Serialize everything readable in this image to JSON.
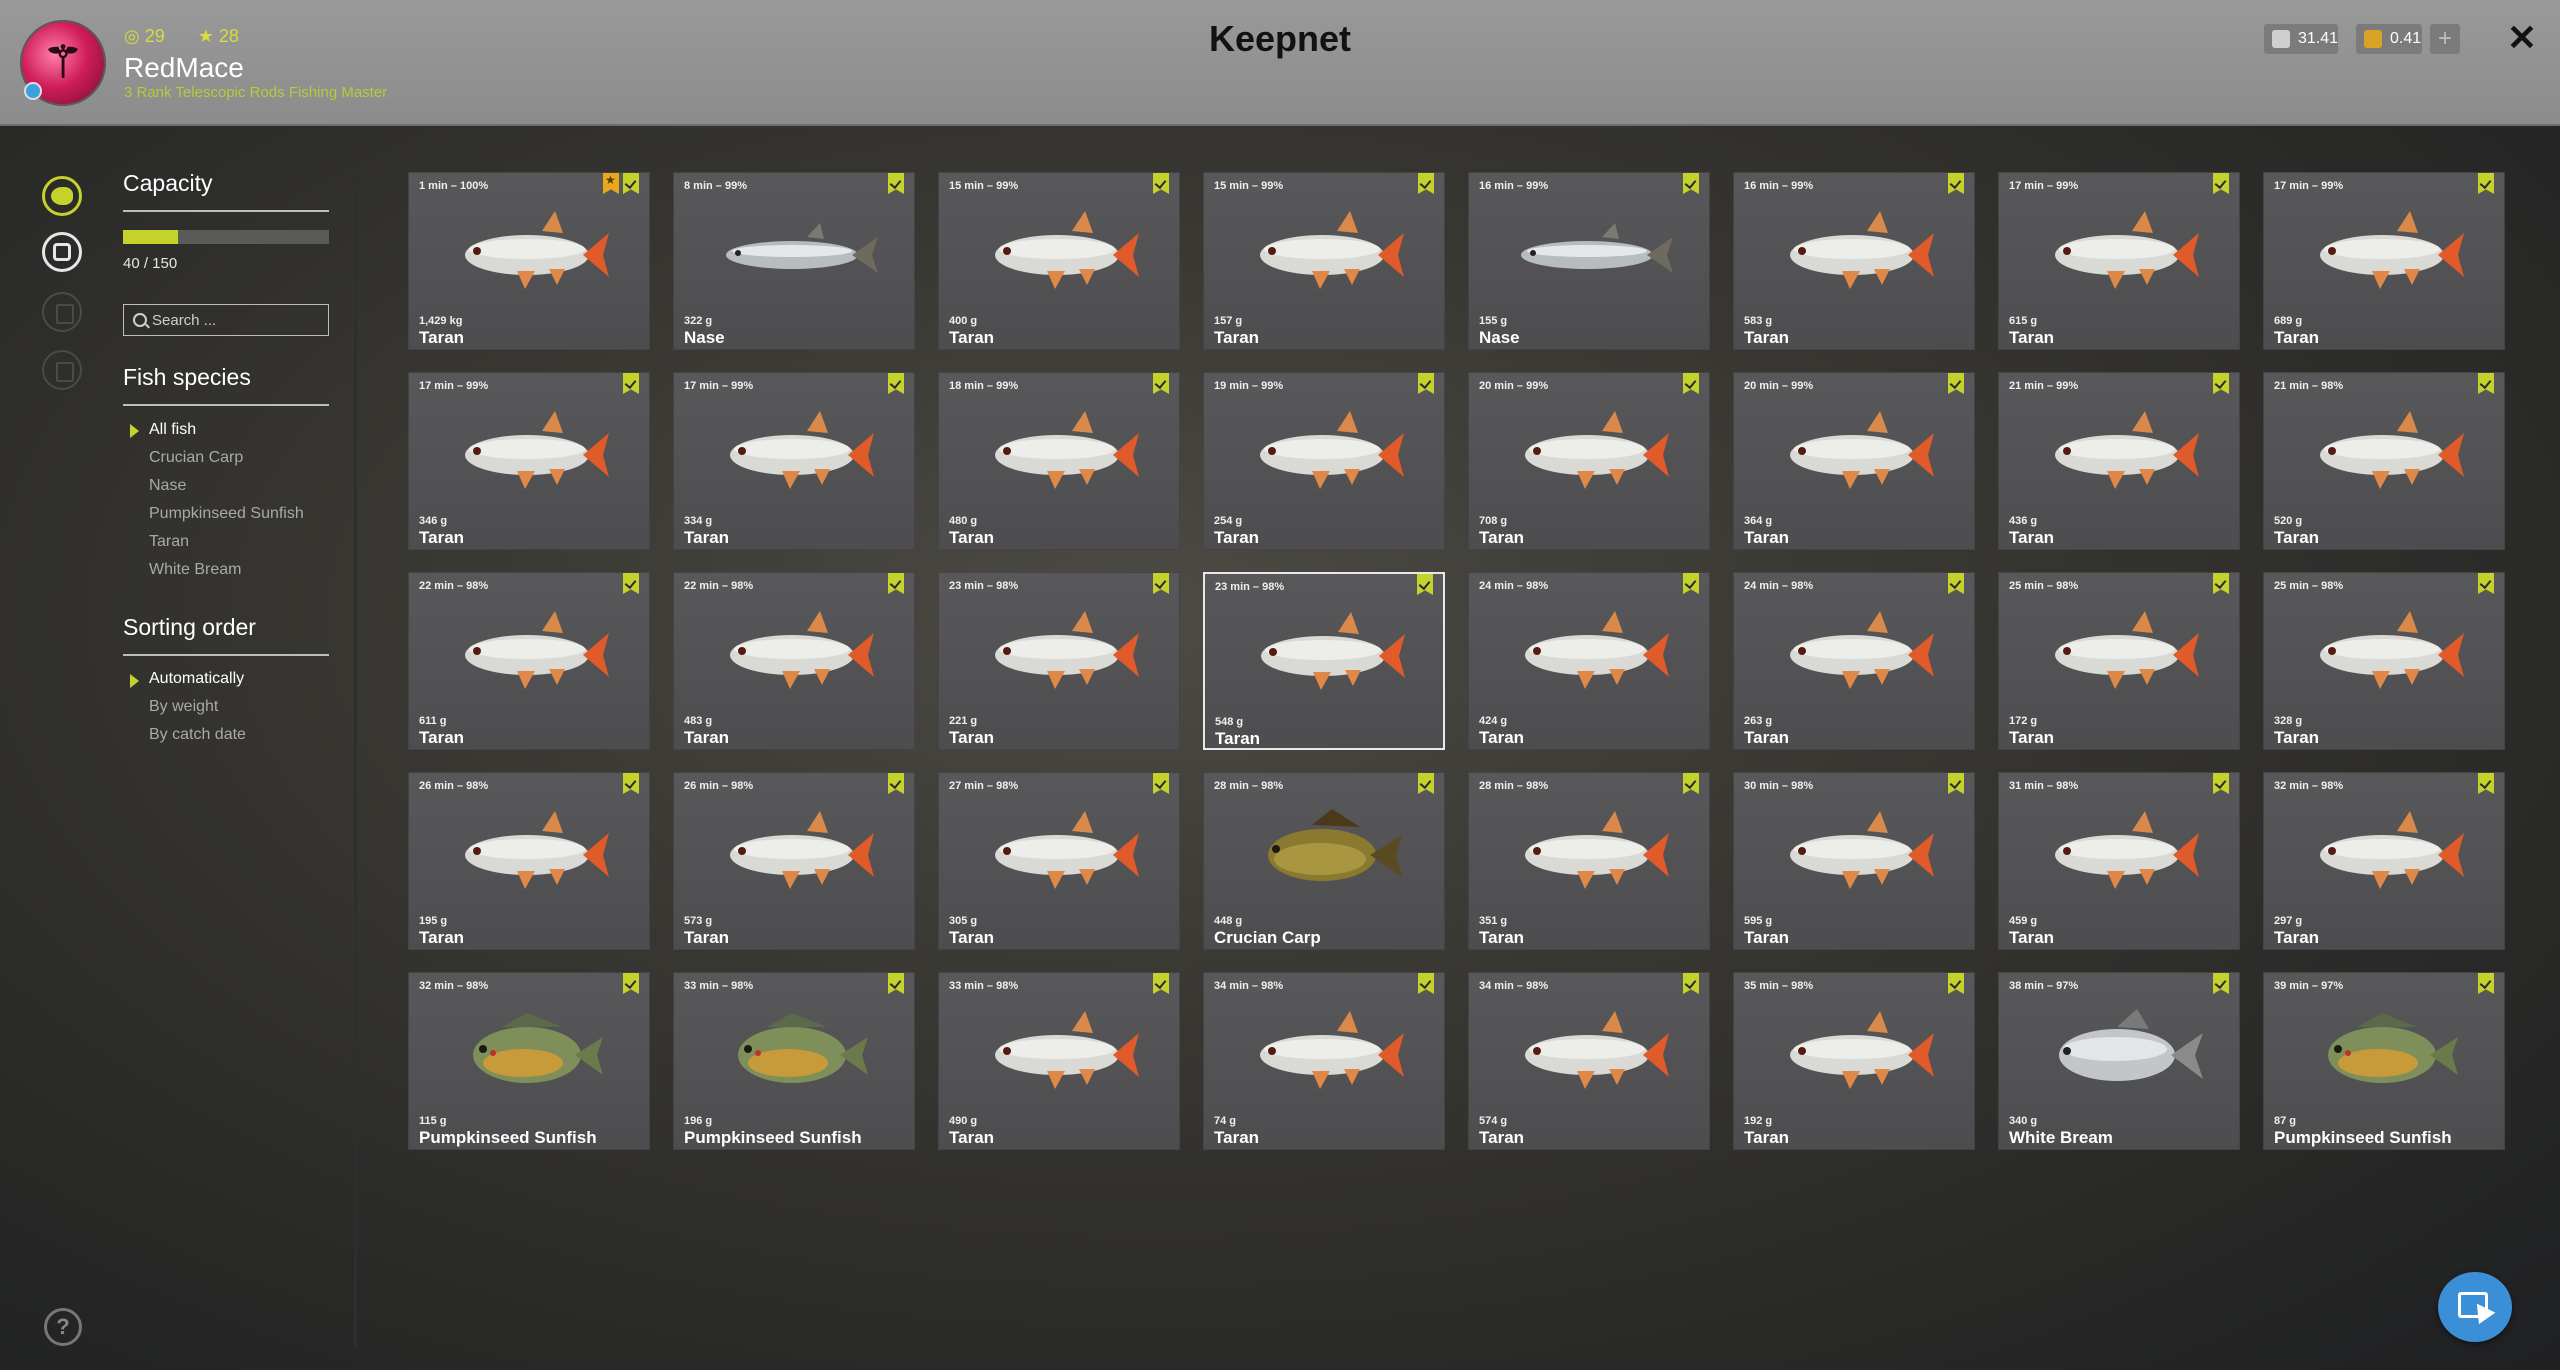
{
  "header": {
    "title": "Keepnet",
    "player": {
      "name": "RedMace",
      "rank_text": "3 Rank Telescopic Rods Fishing Master",
      "level": "29",
      "stars": "28"
    },
    "currency": [
      {
        "name": "silver",
        "value": "31.41",
        "color": "#cfcfcf"
      },
      {
        "name": "gold",
        "value": "0.41",
        "color": "#d9a326"
      }
    ],
    "add_label": "+",
    "close_label": "✕"
  },
  "sidebar": {
    "capacity_title": "Capacity",
    "capacity_text": "40 / 150",
    "capacity_fraction": 0.267,
    "search_placeholder": "Search ...",
    "species_title": "Fish species",
    "species": [
      "All fish",
      "Crucian Carp",
      "Nase",
      "Pumpkinseed Sunfish",
      "Taran",
      "White Bream"
    ],
    "species_selected": 0,
    "sorting_title": "Sorting order",
    "sorting": [
      "Automatically",
      "By weight",
      "By catch date"
    ],
    "sorting_selected": 0,
    "help_label": "?"
  },
  "colors": {
    "accent": "#c6d22c",
    "favorite": "#e8a81e"
  },
  "fish": [
    {
      "time": "1 min – 100%",
      "weight": "1,429 kg",
      "name": "Taran",
      "fav": true
    },
    {
      "time": "8 min – 99%",
      "weight": "322 g",
      "name": "Nase"
    },
    {
      "time": "15 min – 99%",
      "weight": "400 g",
      "name": "Taran"
    },
    {
      "time": "15 min – 99%",
      "weight": "157 g",
      "name": "Taran"
    },
    {
      "time": "16 min – 99%",
      "weight": "155 g",
      "name": "Nase"
    },
    {
      "time": "16 min – 99%",
      "weight": "583 g",
      "name": "Taran"
    },
    {
      "time": "17 min – 99%",
      "weight": "615 g",
      "name": "Taran"
    },
    {
      "time": "17 min – 99%",
      "weight": "689 g",
      "name": "Taran"
    },
    {
      "time": "17 min – 99%",
      "weight": "346 g",
      "name": "Taran"
    },
    {
      "time": "17 min – 99%",
      "weight": "334 g",
      "name": "Taran"
    },
    {
      "time": "18 min – 99%",
      "weight": "480 g",
      "name": "Taran"
    },
    {
      "time": "19 min – 99%",
      "weight": "254 g",
      "name": "Taran"
    },
    {
      "time": "20 min – 99%",
      "weight": "708 g",
      "name": "Taran"
    },
    {
      "time": "20 min – 99%",
      "weight": "364 g",
      "name": "Taran"
    },
    {
      "time": "21 min – 99%",
      "weight": "436 g",
      "name": "Taran"
    },
    {
      "time": "21 min – 98%",
      "weight": "520 g",
      "name": "Taran"
    },
    {
      "time": "22 min – 98%",
      "weight": "611 g",
      "name": "Taran"
    },
    {
      "time": "22 min – 98%",
      "weight": "483 g",
      "name": "Taran"
    },
    {
      "time": "23 min – 98%",
      "weight": "221 g",
      "name": "Taran"
    },
    {
      "time": "23 min – 98%",
      "weight": "548 g",
      "name": "Taran",
      "selected": true
    },
    {
      "time": "24 min – 98%",
      "weight": "424 g",
      "name": "Taran"
    },
    {
      "time": "24 min – 98%",
      "weight": "263 g",
      "name": "Taran"
    },
    {
      "time": "25 min – 98%",
      "weight": "172 g",
      "name": "Taran"
    },
    {
      "time": "25 min – 98%",
      "weight": "328 g",
      "name": "Taran"
    },
    {
      "time": "26 min – 98%",
      "weight": "195 g",
      "name": "Taran"
    },
    {
      "time": "26 min – 98%",
      "weight": "573 g",
      "name": "Taran"
    },
    {
      "time": "27 min – 98%",
      "weight": "305 g",
      "name": "Taran"
    },
    {
      "time": "28 min – 98%",
      "weight": "448 g",
      "name": "Crucian Carp"
    },
    {
      "time": "28 min – 98%",
      "weight": "351 g",
      "name": "Taran"
    },
    {
      "time": "30 min – 98%",
      "weight": "595 g",
      "name": "Taran"
    },
    {
      "time": "31 min – 98%",
      "weight": "459 g",
      "name": "Taran"
    },
    {
      "time": "32 min – 98%",
      "weight": "297 g",
      "name": "Taran"
    },
    {
      "time": "32 min – 98%",
      "weight": "115 g",
      "name": "Pumpkinseed Sunfish"
    },
    {
      "time": "33 min – 98%",
      "weight": "196 g",
      "name": "Pumpkinseed Sunfish"
    },
    {
      "time": "33 min – 98%",
      "weight": "490 g",
      "name": "Taran"
    },
    {
      "time": "34 min – 98%",
      "weight": "74 g",
      "name": "Taran"
    },
    {
      "time": "34 min – 98%",
      "weight": "574 g",
      "name": "Taran"
    },
    {
      "time": "35 min – 98%",
      "weight": "192 g",
      "name": "Taran"
    },
    {
      "time": "38 min – 97%",
      "weight": "340 g",
      "name": "White Bream"
    },
    {
      "time": "39 min – 97%",
      "weight": "87 g",
      "name": "Pumpkinseed Sunfish"
    }
  ]
}
